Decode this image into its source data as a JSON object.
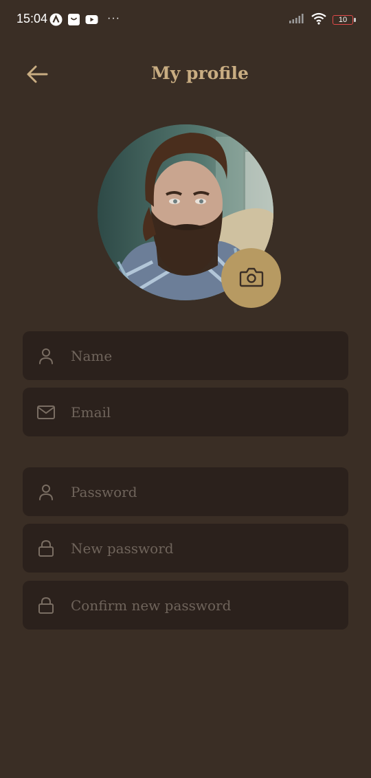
{
  "status_bar": {
    "time": "15:04",
    "dots": "···",
    "battery_level": "10",
    "icons": [
      "app-a-icon",
      "shopping-bag-icon",
      "youtube-icon",
      "signal-icon",
      "wifi-icon",
      "battery-icon"
    ]
  },
  "header": {
    "title": "My profile",
    "back_icon": "arrow-left-icon"
  },
  "avatar": {
    "camera_icon": "camera-icon"
  },
  "fields": {
    "name": {
      "placeholder": "Name",
      "value": "",
      "icon": "user-icon"
    },
    "email": {
      "placeholder": "Email",
      "value": "",
      "icon": "mail-icon"
    },
    "password": {
      "placeholder": "Password",
      "value": "",
      "icon": "user-icon"
    },
    "new_password": {
      "placeholder": "New password",
      "value": "",
      "icon": "lock-icon"
    },
    "confirm_password": {
      "placeholder": "Confirm new password",
      "value": "",
      "icon": "lock-icon"
    }
  },
  "colors": {
    "background": "#3a2e25",
    "field_background": "#2b211c",
    "accent": "#b79a62",
    "title": "#c9ad82",
    "placeholder": "#6f645b"
  }
}
